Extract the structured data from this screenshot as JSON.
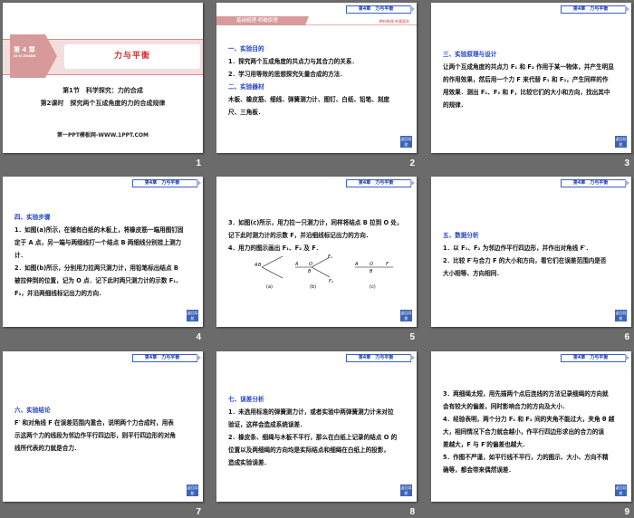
{
  "header_badge": "第4章　力与平衡",
  "nav_button": "返回导航",
  "slide1": {
    "chapter": "第 4 章",
    "chapter_pinyin": "DI SI ZHANG",
    "title": "力与平衡",
    "section": "第1节　科学探究：力的合成",
    "lesson": "第2课时　探究两个互成角度的力的合成规律",
    "footer": "第一PPT模板网-WWW.1PPT.COM"
  },
  "slide2": {
    "banner": "基础梳理·明确原理",
    "banner_right": "教材梳理·夯基固本",
    "lines": [
      {
        "t": "一、实验目的",
        "h": true
      },
      {
        "t": "1．探究两个互成角度的共点力与其合力的关系．"
      },
      {
        "t": "2．学习用等效的思想探究矢量合成的方法．"
      },
      {
        "t": "二、实验器材",
        "h": true
      },
      {
        "t": "木板、橡皮筋、细线、弹簧测力计、图钉、白纸、铅笔、刻度"
      },
      {
        "t": "尺、三角板．"
      }
    ]
  },
  "slide3": {
    "lines": [
      {
        "t": "三、实验原理与设计",
        "h": true
      },
      {
        "t": "让两个互成角度的共点力 F₁ 和 F₂ 作用于某一物体，并产生明显"
      },
      {
        "t": "的作用效果，然后用一个力 F 来代替 F₁ 和 F₂，产生同样的作"
      },
      {
        "t": "用效果．测出 F₁、F₂ 和 F，比较它们的大小和方向，找出其中"
      },
      {
        "t": "的规律．"
      }
    ]
  },
  "slide4": {
    "lines": [
      {
        "t": "四、实验步骤",
        "h": true
      },
      {
        "t": "1．如图(a)所示，在铺有白纸的木板上，将橡皮筋一端用图钉固"
      },
      {
        "t": "定于 A 点，另一端与两细线打一个结点 B 两细线分别挂上测力"
      },
      {
        "t": "计．"
      },
      {
        "t": "2．如图(b)所示，分别用力拉两只测力计，用铅笔标出结点 B"
      },
      {
        "t": "被拉伸到的位置，记为 O 点．记下此时两只测力计的示数 F₁、"
      },
      {
        "t": "F₂，并沿两细线标记出力的方向．"
      }
    ]
  },
  "slide5": {
    "lines": [
      {
        "t": "3．如图(c)所示，用力拉一只测力计，同样将结点 B 拉到 O 处，"
      },
      {
        "t": "记下此时测力计的示数 F，并沿细线标记出力的方向．"
      },
      {
        "t": "4．用力的图示画出 F₁、F₂ 及 F．"
      }
    ],
    "figure": {
      "a_labels": [
        "A",
        "B"
      ],
      "b_labels": [
        "A",
        "O",
        "B",
        "F₁",
        "F₂"
      ],
      "c_labels": [
        "A",
        "O",
        "B",
        "F"
      ],
      "captions": [
        "(a)",
        "(b)",
        "(c)"
      ]
    }
  },
  "slide6": {
    "lines": [
      {
        "t": "五、数据分析",
        "h": true
      },
      {
        "t": "1．以 F₁、F₂ 为邻边作平行四边形，并作出对角线 F′．"
      },
      {
        "t": "2．比较 F′与合力 F 的大小和方向，看它们在误差范围内是否"
      },
      {
        "t": "大小相等、方向相同．"
      }
    ]
  },
  "slide7": {
    "lines": [
      {
        "t": "六、实验结论",
        "h": true
      },
      {
        "t": "F′ 和对角线 F 在误差范围内重合，说明两个力合成时，用表"
      },
      {
        "t": "示这两个力的线段为邻边作平行四边形，则平行四边形的对角"
      },
      {
        "t": "线所代表的力就是合力．"
      }
    ]
  },
  "slide8": {
    "lines": [
      {
        "t": "七、误差分析",
        "h": true
      },
      {
        "t": "1．未选用标准的弹簧测力计，或者实验中两弹簧测力计未对拉"
      },
      {
        "t": "验证，这样会造成系统误差．"
      },
      {
        "t": "2．橡皮条、细绳与木板不平行，那么在白纸上记录的结点 O 的"
      },
      {
        "t": "位置以及两细绳的方向均是实际结点和细绳在白纸上的投影，"
      },
      {
        "t": "造成实验误差．"
      }
    ]
  },
  "slide9": {
    "lines": [
      {
        "t": "3．两细绳太短，用先描两个点后连线的方法记录细绳的方向就"
      },
      {
        "t": "会有较大的偏差，同时影响合力的方向及大小．"
      },
      {
        "t": "4．经验表明，两个分力 F₁ 和 F₂ 间的夹角不能过大，夹角 θ 越"
      },
      {
        "t": "大，相同情况下合力就会越小，作平行四边形求出的合力的误"
      },
      {
        "t": "差越大，F 与 F′的偏差也越大．"
      },
      {
        "t": "5．作图不严谨，如平行线不平行，力的图示、大小、方向不精"
      },
      {
        "t": "确等，都会带来偶然误差．"
      }
    ]
  },
  "slide_numbers": [
    "1",
    "2",
    "3",
    "4",
    "5",
    "6",
    "7",
    "8",
    "9"
  ]
}
